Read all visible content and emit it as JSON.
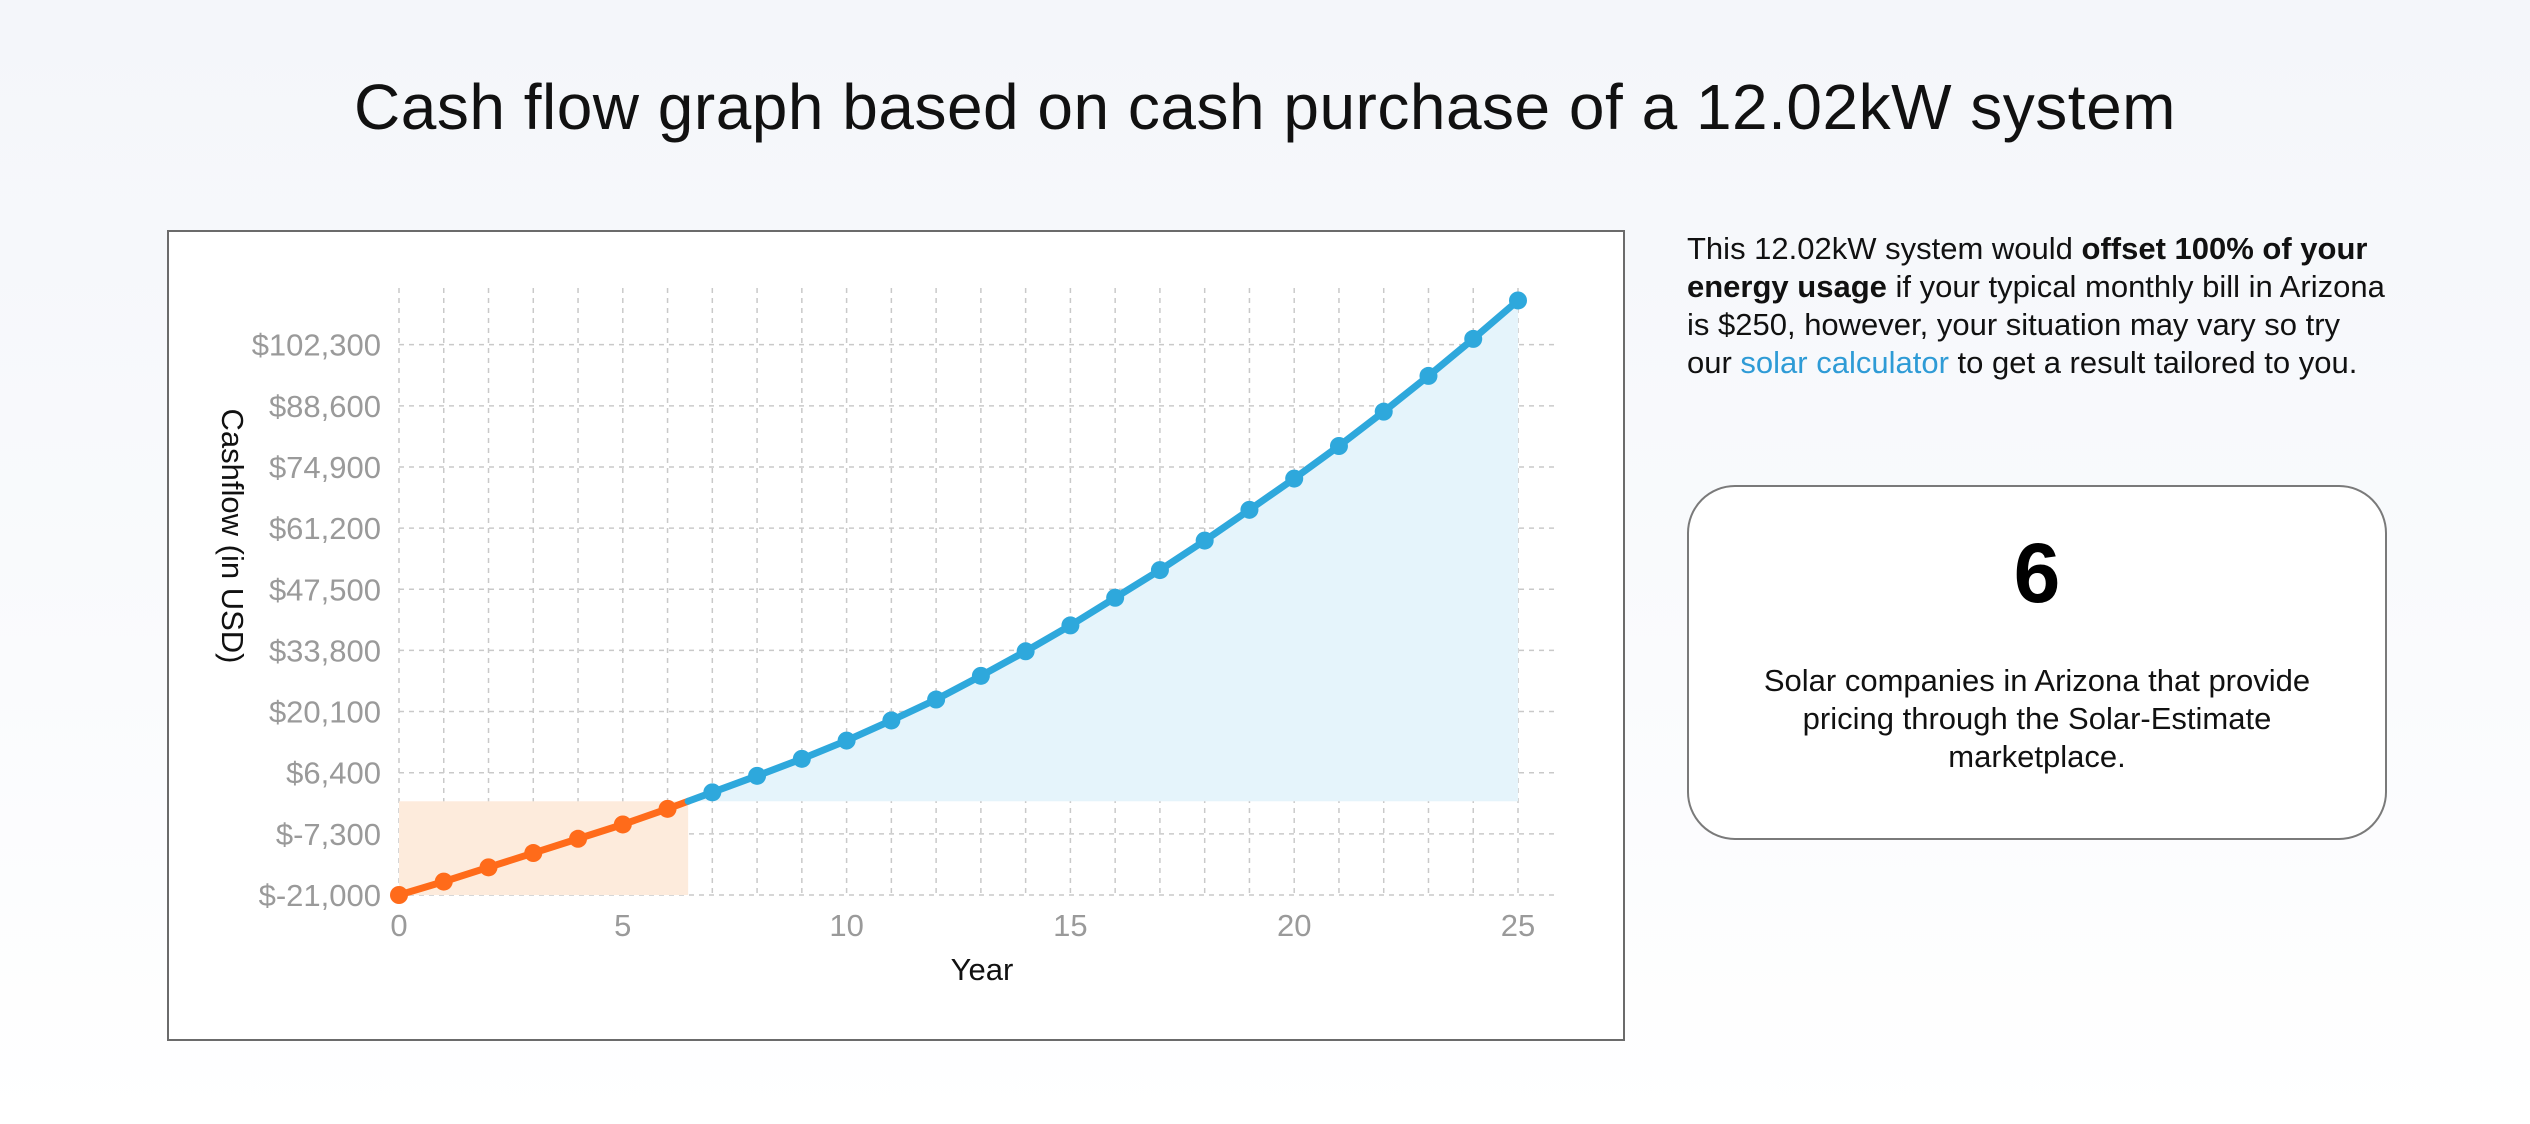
{
  "page": {
    "title": "Cash flow graph based on cash purchase of a 12.02kW system"
  },
  "side": {
    "text_1": "This 12.02kW system would ",
    "bold_1": "offset 100% of your energy usage",
    "text_2": " if your typical monthly bill in Arizona is $250, however, your situation may vary so try our ",
    "link": "solar calculator",
    "text_3": " to get a result tailored to you."
  },
  "stat": {
    "number": "6",
    "caption": "Solar companies in Arizona that provide pricing through the Solar-Estimate marketplace."
  },
  "colors": {
    "negative": "#ff6b1a",
    "positive": "#2ea8dc",
    "negative_fill": "#fdebdc",
    "positive_fill": "#e5f4fb",
    "grid": "#c9c9c9"
  },
  "chart_data": {
    "type": "area",
    "xlabel": "Year",
    "ylabel": "Cashflow (in USD)",
    "xlim": [
      0,
      25
    ],
    "ylim": [
      -21000,
      115000
    ],
    "x_ticks": [
      0,
      5,
      10,
      15,
      20,
      25
    ],
    "y_ticks": [
      -21000,
      -7300,
      6400,
      20100,
      33800,
      47500,
      61200,
      74900,
      88600,
      102300
    ],
    "y_tick_labels": [
      "$-21,000",
      "$-7,300",
      "$6,400",
      "$20,100",
      "$33,800",
      "$47,500",
      "$61,200",
      "$74,900",
      "$88,600",
      "$102,300"
    ],
    "grid": true,
    "legend": "none",
    "series": [
      {
        "x": [
          0,
          1,
          2,
          3,
          4,
          5,
          6,
          7,
          8,
          9,
          10,
          11,
          12,
          13,
          14,
          15,
          16,
          17,
          18,
          19,
          20,
          21,
          22,
          23,
          24,
          25
        ],
        "values": [
          -21000,
          -18000,
          -14800,
          -11600,
          -8400,
          -5200,
          -1700,
          2000,
          5700,
          9500,
          13600,
          18100,
          22800,
          28100,
          33600,
          39400,
          45600,
          51800,
          58400,
          65300,
          72300,
          79600,
          87300,
          95300,
          103600,
          112200
        ]
      }
    ]
  }
}
